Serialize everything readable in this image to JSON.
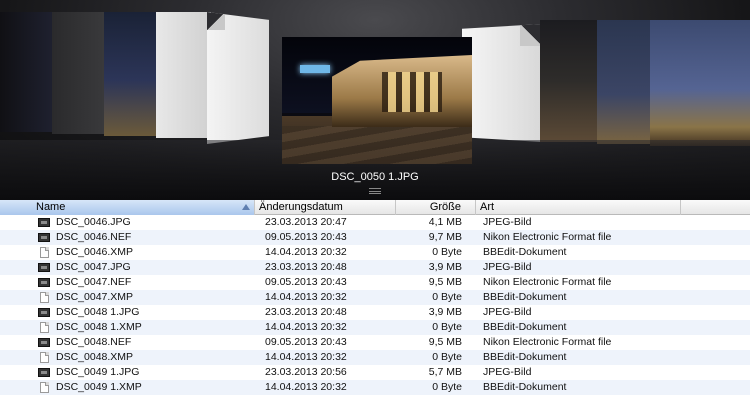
{
  "coverflow": {
    "caption": "DSC_0050 1.JPG"
  },
  "columns": {
    "name": "Name",
    "date": "Änderungsdatum",
    "size": "Größe",
    "kind": "Art"
  },
  "files": [
    {
      "name": "DSC_0046.JPG",
      "date": "23.03.2013 20:47",
      "size": "4,1 MB",
      "kind": "JPEG-Bild",
      "icon": "image-file-icon"
    },
    {
      "name": "DSC_0046.NEF",
      "date": "09.05.2013 20:43",
      "size": "9,7 MB",
      "kind": "Nikon Electronic Format file",
      "icon": "image-file-icon"
    },
    {
      "name": "DSC_0046.XMP",
      "date": "14.04.2013 20:32",
      "size": "0 Byte",
      "kind": "BBEdit-Dokument",
      "icon": "document-icon"
    },
    {
      "name": "DSC_0047.JPG",
      "date": "23.03.2013 20:48",
      "size": "3,9 MB",
      "kind": "JPEG-Bild",
      "icon": "image-file-icon"
    },
    {
      "name": "DSC_0047.NEF",
      "date": "09.05.2013 20:43",
      "size": "9,5 MB",
      "kind": "Nikon Electronic Format file",
      "icon": "image-file-icon"
    },
    {
      "name": "DSC_0047.XMP",
      "date": "14.04.2013 20:32",
      "size": "0 Byte",
      "kind": "BBEdit-Dokument",
      "icon": "document-icon"
    },
    {
      "name": "DSC_0048 1.JPG",
      "date": "23.03.2013 20:48",
      "size": "3,9 MB",
      "kind": "JPEG-Bild",
      "icon": "image-file-icon"
    },
    {
      "name": "DSC_0048 1.XMP",
      "date": "14.04.2013 20:32",
      "size": "0 Byte",
      "kind": "BBEdit-Dokument",
      "icon": "document-icon"
    },
    {
      "name": "DSC_0048.NEF",
      "date": "09.05.2013 20:43",
      "size": "9,5 MB",
      "kind": "Nikon Electronic Format file",
      "icon": "image-file-icon"
    },
    {
      "name": "DSC_0048.XMP",
      "date": "14.04.2013 20:32",
      "size": "0 Byte",
      "kind": "BBEdit-Dokument",
      "icon": "document-icon"
    },
    {
      "name": "DSC_0049 1.JPG",
      "date": "23.03.2013 20:56",
      "size": "5,7 MB",
      "kind": "JPEG-Bild",
      "icon": "image-file-icon"
    },
    {
      "name": "DSC_0049 1.XMP",
      "date": "14.04.2013 20:32",
      "size": "0 Byte",
      "kind": "BBEdit-Dokument",
      "icon": "document-icon"
    }
  ]
}
